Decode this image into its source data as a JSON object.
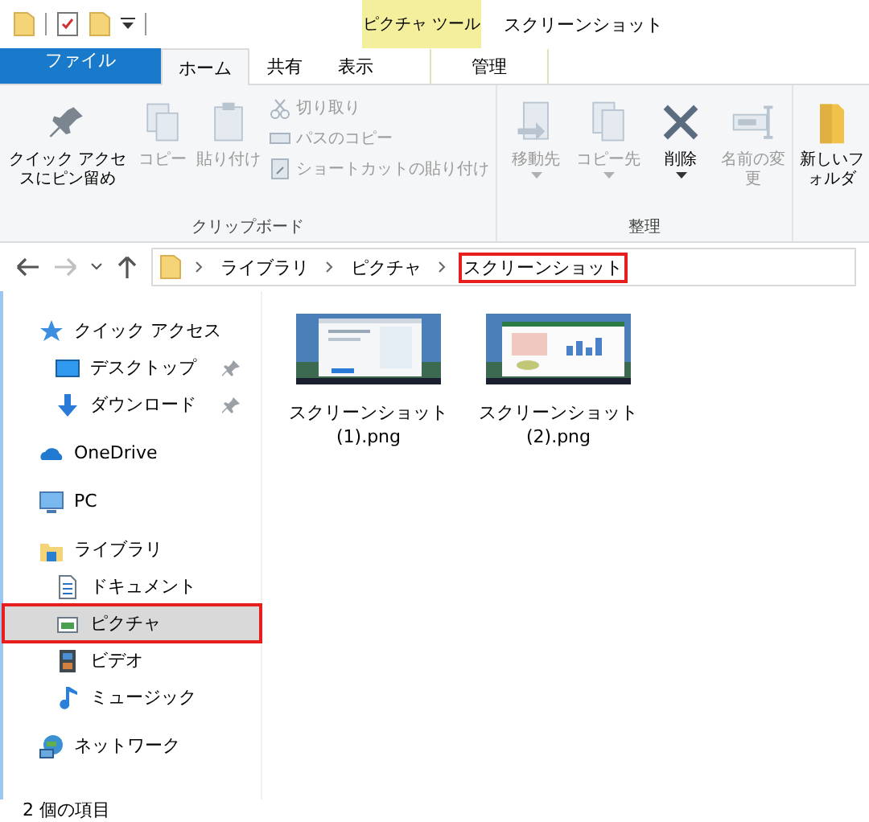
{
  "title_bar": {
    "context_tab": "ピクチャ ツール",
    "title": "スクリーンショット"
  },
  "ribbon_tabs": [
    {
      "label": "ファイル",
      "kind": "file",
      "selected": false
    },
    {
      "label": "ホーム",
      "kind": "tab",
      "selected": true
    },
    {
      "label": "共有",
      "kind": "tab",
      "selected": false
    },
    {
      "label": "表示",
      "kind": "tab",
      "selected": false
    },
    {
      "label": "管理",
      "kind": "context",
      "selected": false
    }
  ],
  "ribbon_groups": [
    {
      "label": "クリップボード",
      "commands": [
        {
          "label": "クイック アクセスにピン留め",
          "kind": "large",
          "disabled": false,
          "dropdown": false
        },
        {
          "label": "コピー",
          "kind": "large",
          "disabled": true,
          "dropdown": false
        },
        {
          "label": "貼り付け",
          "kind": "large",
          "disabled": true,
          "dropdown": false
        },
        {
          "label": "切り取り",
          "kind": "small",
          "disabled": true
        },
        {
          "label": "パスのコピー",
          "kind": "small",
          "disabled": true
        },
        {
          "label": "ショートカットの貼り付け",
          "kind": "small",
          "disabled": true
        }
      ]
    },
    {
      "label": "整理",
      "commands": [
        {
          "label": "移動先",
          "kind": "large",
          "disabled": true,
          "dropdown": true
        },
        {
          "label": "コピー先",
          "kind": "large",
          "disabled": true,
          "dropdown": true
        },
        {
          "label": "削除",
          "kind": "large",
          "disabled": false,
          "dropdown": true
        },
        {
          "label": "名前の変更",
          "kind": "large",
          "disabled": true,
          "dropdown": false
        }
      ]
    },
    {
      "commands": [
        {
          "label": "新しいフォルダ",
          "kind": "large",
          "disabled": false,
          "dropdown": false
        }
      ]
    }
  ],
  "navigation": {
    "back_disabled": false,
    "forward_disabled": true
  },
  "breadcrumb": [
    {
      "label": "ライブラリ",
      "highlighted": false
    },
    {
      "label": "ピクチャ",
      "highlighted": false
    },
    {
      "label": "スクリーンショット",
      "highlighted": true
    }
  ],
  "sidebar": [
    {
      "label": "クイック アクセス",
      "kind": "quick",
      "selected": false,
      "highlighted": false,
      "children": [
        {
          "label": "デスクトップ",
          "kind": "desktop",
          "pinned": true,
          "selected": false,
          "highlighted": false
        },
        {
          "label": "ダウンロード",
          "kind": "download",
          "pinned": true,
          "selected": false,
          "highlighted": false
        }
      ]
    },
    {
      "label": "OneDrive",
      "kind": "cloud",
      "selected": false,
      "highlighted": false
    },
    {
      "label": "PC",
      "kind": "pc",
      "selected": false,
      "highlighted": false
    },
    {
      "label": "ライブラリ",
      "kind": "library",
      "selected": false,
      "highlighted": false,
      "children": [
        {
          "label": "ドキュメント",
          "kind": "documents",
          "selected": false,
          "highlighted": false
        },
        {
          "label": "ピクチャ",
          "kind": "pictures",
          "selected": true,
          "highlighted": true
        },
        {
          "label": "ビデオ",
          "kind": "videos",
          "selected": false,
          "highlighted": false
        },
        {
          "label": "ミュージック",
          "kind": "music",
          "selected": false,
          "highlighted": false
        }
      ]
    },
    {
      "label": "ネットワーク",
      "kind": "network",
      "selected": false,
      "highlighted": false
    }
  ],
  "files": [
    {
      "name": "スクリーンショット (1).png",
      "kind": "picture"
    },
    {
      "name": "スクリーンショット (2).png",
      "kind": "picture"
    }
  ],
  "status_bar": "2 個の項目"
}
